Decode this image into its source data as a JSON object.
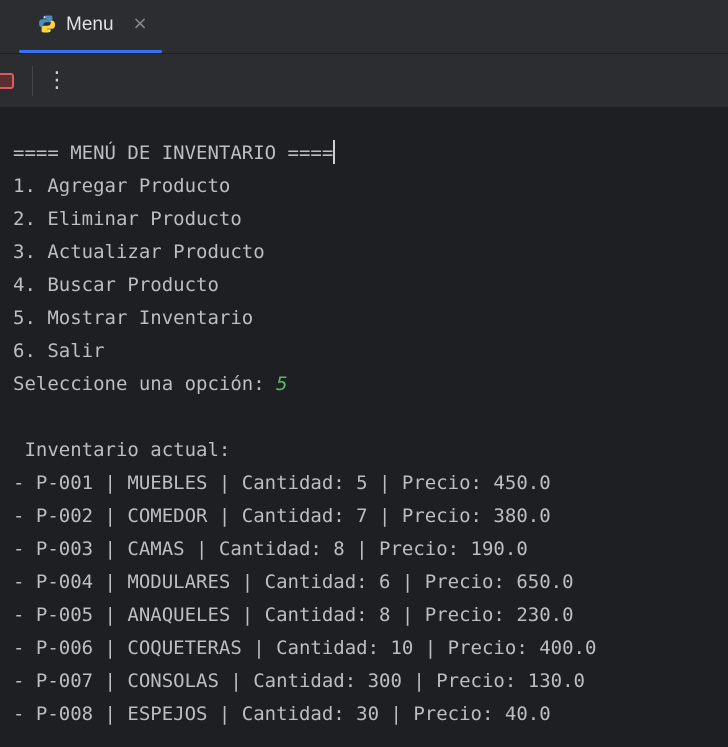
{
  "tab": {
    "title": "Menu",
    "icon": "python-icon",
    "close_icon": "close-icon",
    "accent_color": "#3574f0"
  },
  "toolbar": {
    "stop_icon": "stop-icon",
    "more_icon": "more-vertical-icon",
    "more_glyph": "⋮"
  },
  "console": {
    "menu_header": "==== MENÚ DE INVENTARIO ====",
    "menu_options": [
      "1. Agregar Producto",
      "2. Eliminar Producto",
      "3. Actualizar Producto",
      "4. Buscar Producto",
      "5. Mostrar Inventario",
      "6. Salir"
    ],
    "prompt": "Seleccione una opción: ",
    "user_input": "5",
    "user_input_color": "#5fb865",
    "inventory_header": " Inventario actual:",
    "inventory_items": [
      "- P-001 | MUEBLES | Cantidad: 5 | Precio: 450.0",
      "- P-002 | COMEDOR | Cantidad: 7 | Precio: 380.0",
      "- P-003 | CAMAS | Cantidad: 8 | Precio: 190.0",
      "- P-004 | MODULARES | Cantidad: 6 | Precio: 650.0",
      "- P-005 | ANAQUELES | Cantidad: 8 | Precio: 230.0",
      "- P-006 | COQUETERAS | Cantidad: 10 | Precio: 400.0",
      "- P-007 | CONSOLAS | Cantidad: 300 | Precio: 130.0",
      "- P-008 | ESPEJOS | Cantidad: 30 | Precio: 40.0"
    ]
  }
}
